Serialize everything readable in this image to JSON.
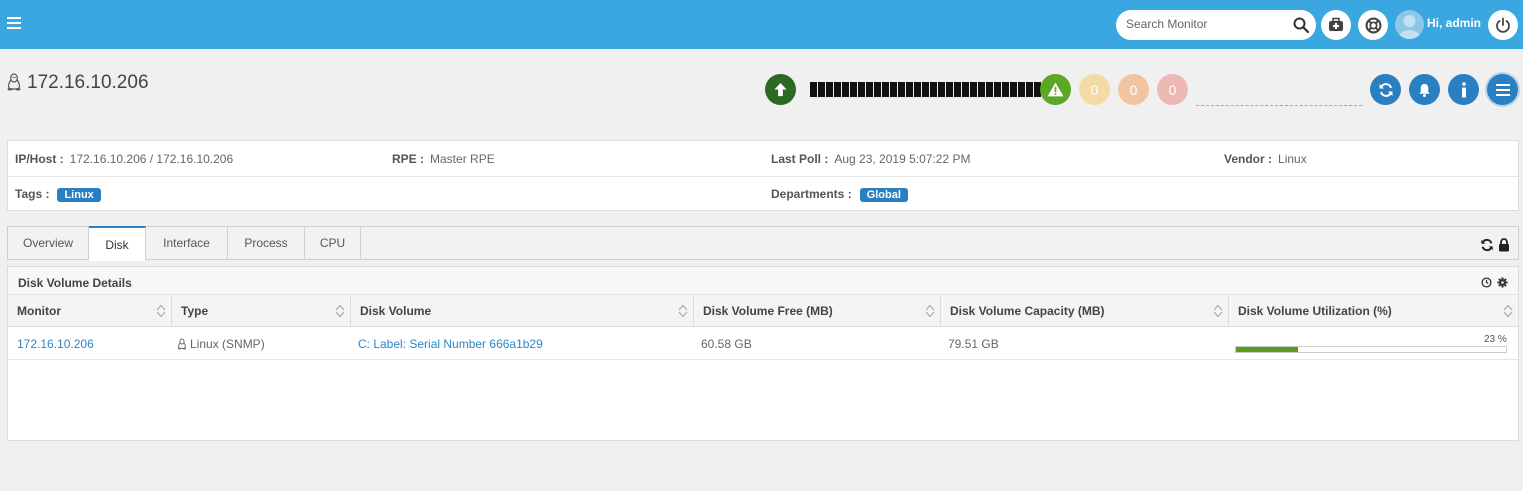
{
  "search": {
    "placeholder": "Search Monitor"
  },
  "user": {
    "greeting": "Hi, admin"
  },
  "monitor": {
    "title": "172.16.10.206"
  },
  "alerts": {
    "critical": "0",
    "major": "0",
    "minor": "0"
  },
  "availability": {
    "segments": 30
  },
  "info": {
    "ip_label": "IP/Host :",
    "ip_value": "172.16.10.206 / 172.16.10.206",
    "rpe_label": "RPE :",
    "rpe_value": "Master RPE",
    "poll_label": "Last Poll :",
    "poll_value": "Aug 23, 2019 5:07:22 PM",
    "vendor_label": "Vendor :",
    "vendor_value": "Linux",
    "tags_label": "Tags :",
    "tag_value": "Linux",
    "dept_label": "Departments :",
    "dept_value": "Global"
  },
  "tabs": [
    {
      "label": "Overview"
    },
    {
      "label": "Disk"
    },
    {
      "label": "Interface"
    },
    {
      "label": "Process"
    },
    {
      "label": "CPU"
    }
  ],
  "disk_panel": {
    "title": "Disk Volume Details",
    "columns": [
      "Monitor",
      "Type",
      "Disk Volume",
      "Disk Volume Free (MB)",
      "Disk Volume Capacity (MB)",
      "Disk Volume Utilization (%)"
    ],
    "rows": [
      {
        "monitor": "172.16.10.206",
        "type": "Linux (SNMP)",
        "volume": "C: Label: Serial Number 666a1b29",
        "free": "60.58 GB",
        "capacity": "79.51 GB",
        "utilization_label": "23 %",
        "utilization": 23
      }
    ]
  },
  "colors": {
    "topbar": "#3aa7e0",
    "primary": "#2a7fc1",
    "up": "#2c6a24",
    "warning": "#5ab52b"
  }
}
